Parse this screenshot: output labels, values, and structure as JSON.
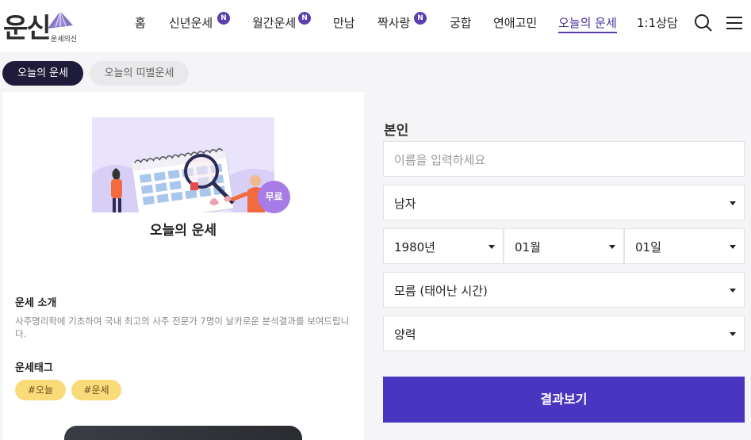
{
  "header": {
    "logo_main": "운신",
    "logo_sub": "운세의신",
    "nav": [
      {
        "label": "홈",
        "badge": ""
      },
      {
        "label": "신년운세",
        "badge": "N"
      },
      {
        "label": "월간운세",
        "badge": "N"
      },
      {
        "label": "만남",
        "badge": ""
      },
      {
        "label": "짝사랑",
        "badge": "N"
      },
      {
        "label": "궁합",
        "badge": ""
      },
      {
        "label": "연애고민",
        "badge": ""
      },
      {
        "label": "오늘의 운세",
        "badge": "",
        "active": true
      },
      {
        "label": "1:1상담",
        "badge": ""
      }
    ],
    "icons": [
      "search-icon",
      "menu-icon"
    ]
  },
  "tabs": [
    {
      "label": "오늘의 운세",
      "active": true
    },
    {
      "label": "오늘의 띠별운세",
      "active": false
    }
  ],
  "card": {
    "badge": "무료",
    "title": "오늘의 운세",
    "intro_heading": "운세 소개",
    "intro_text": "사주명리학에 기초하여 국내 최고의 사주 전문가 7명이 날카로운 분석결과를 보여드립니다.",
    "tags_heading": "운세태그",
    "tags": [
      "#오늘",
      "#운세"
    ]
  },
  "form": {
    "title": "본인",
    "name_placeholder": "이름을 입력하세요",
    "gender": "남자",
    "year": "1980년",
    "month": "01월",
    "day": "01일",
    "birth_time": "모름 (태어난 시간)",
    "calendar": "양력",
    "submit_label": "결과보기"
  },
  "colors": {
    "accent": "#4a35c0",
    "badge": "#5b3fb0",
    "tab_active_bg": "#1f1b3a",
    "tag_bg": "#fadb7a",
    "free_badge": "#a77ce6"
  }
}
